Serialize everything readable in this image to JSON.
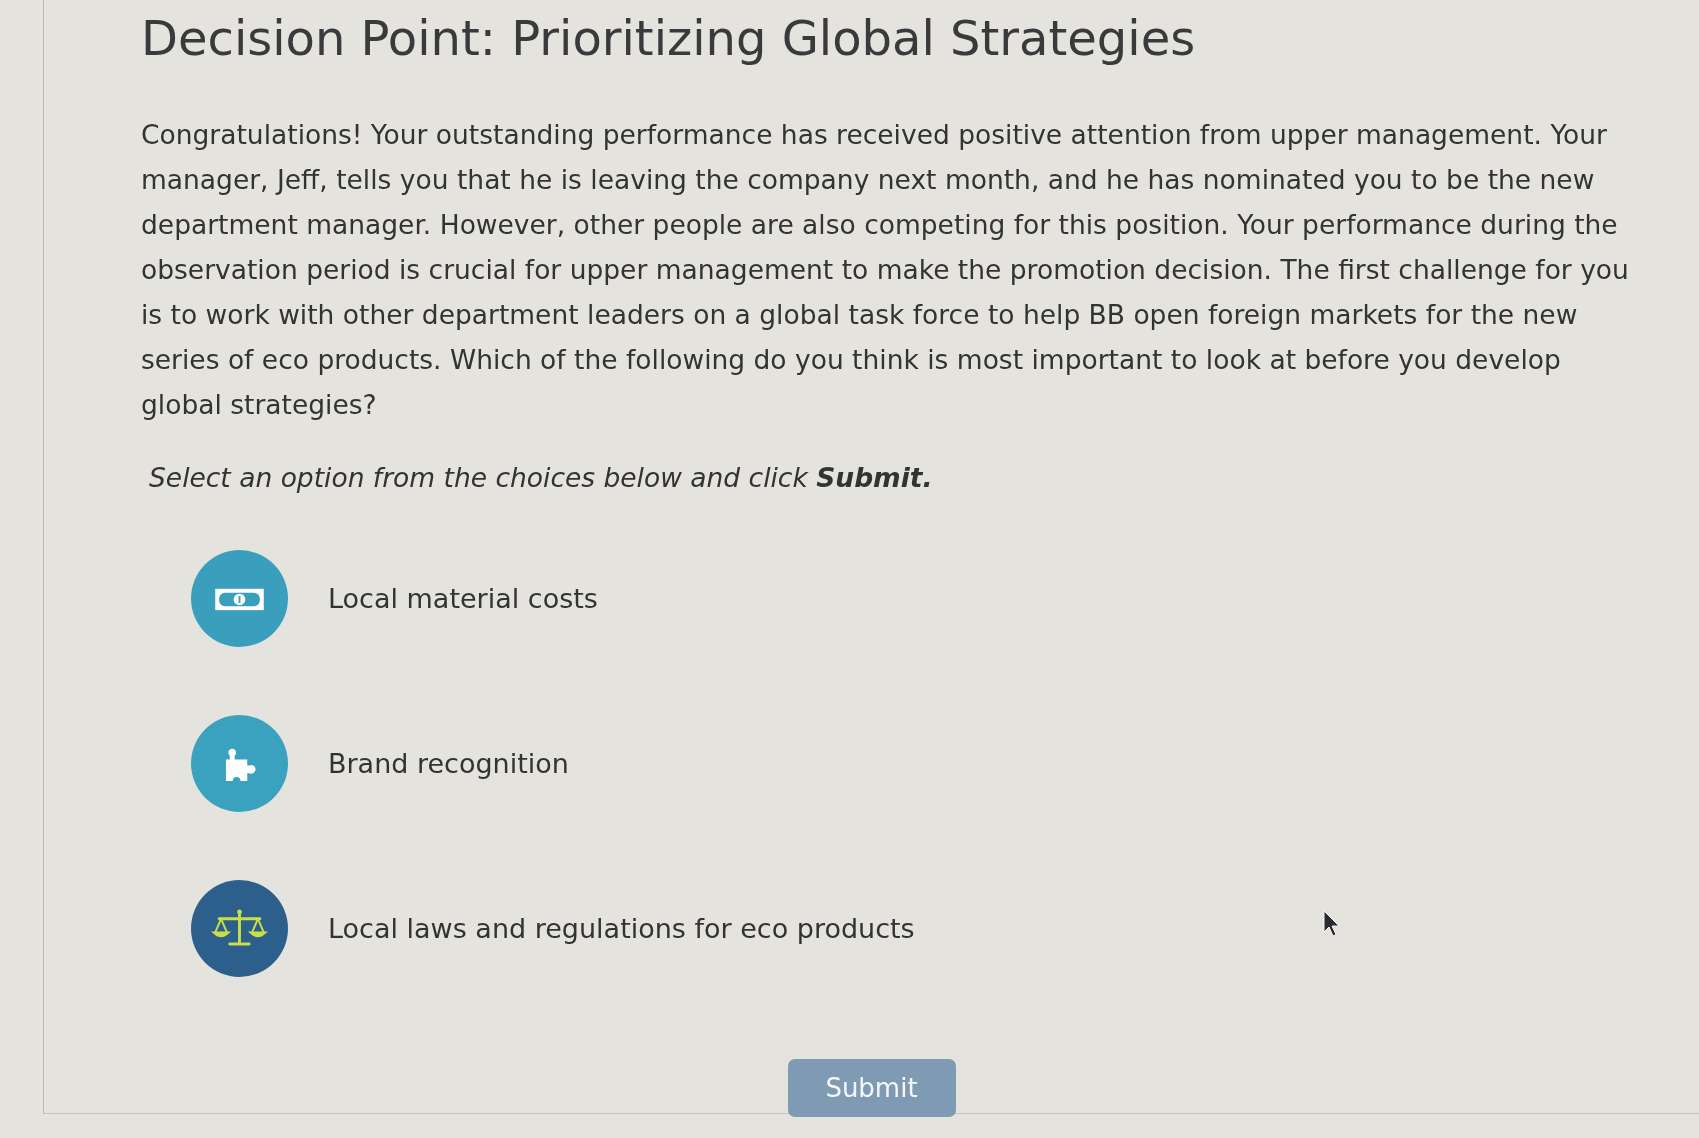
{
  "title": "Decision Point: Prioritizing Global Strategies",
  "intro": "Congratulations! Your outstanding performance has received positive attention from upper management. Your manager, Jeff, tells you that he is leaving the company next month, and he has nominated you to be the new department manager. However, other people are also competing for this position. Your performance during the observation period is crucial for upper management to make the promotion decision. The first challenge for you is to work with other department leaders on a global task force to help BB open foreign markets for the new series of eco products. Which of the following do you think is most important to look at before you develop global strategies?",
  "instruction": "Select an option from the choices below and click **Submit.**",
  "options": [
    {
      "kind": "banknote",
      "label": "Local material costs",
      "selected": false
    },
    {
      "kind": "puzzle",
      "label": "Brand recognition",
      "selected": false
    },
    {
      "kind": "scales",
      "label": "Local laws and regulations for eco products",
      "selected": false
    }
  ],
  "submit_button": {
    "label": "Submit",
    "disabled": true
  }
}
